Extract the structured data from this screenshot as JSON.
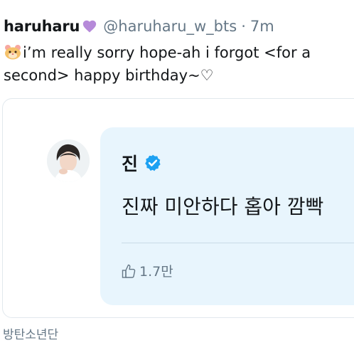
{
  "tweet": {
    "display_name": "haruharu",
    "handle": "@haruharu_w_bts",
    "separator": "·",
    "time": "7m",
    "text": "i’m really sorry hope-ah i forgot <for a second> happy birthday~♡"
  },
  "quoted": {
    "author_name": "진",
    "text": "진짜 미안하다 홉아 깜빡",
    "likes_label": "1.7만"
  },
  "footer": {
    "label": "방탄소년단"
  },
  "colors": {
    "verified": "#1da1f2",
    "bubble": "#e8f5fd",
    "muted": "#657786",
    "heart": "#b68ad9"
  }
}
